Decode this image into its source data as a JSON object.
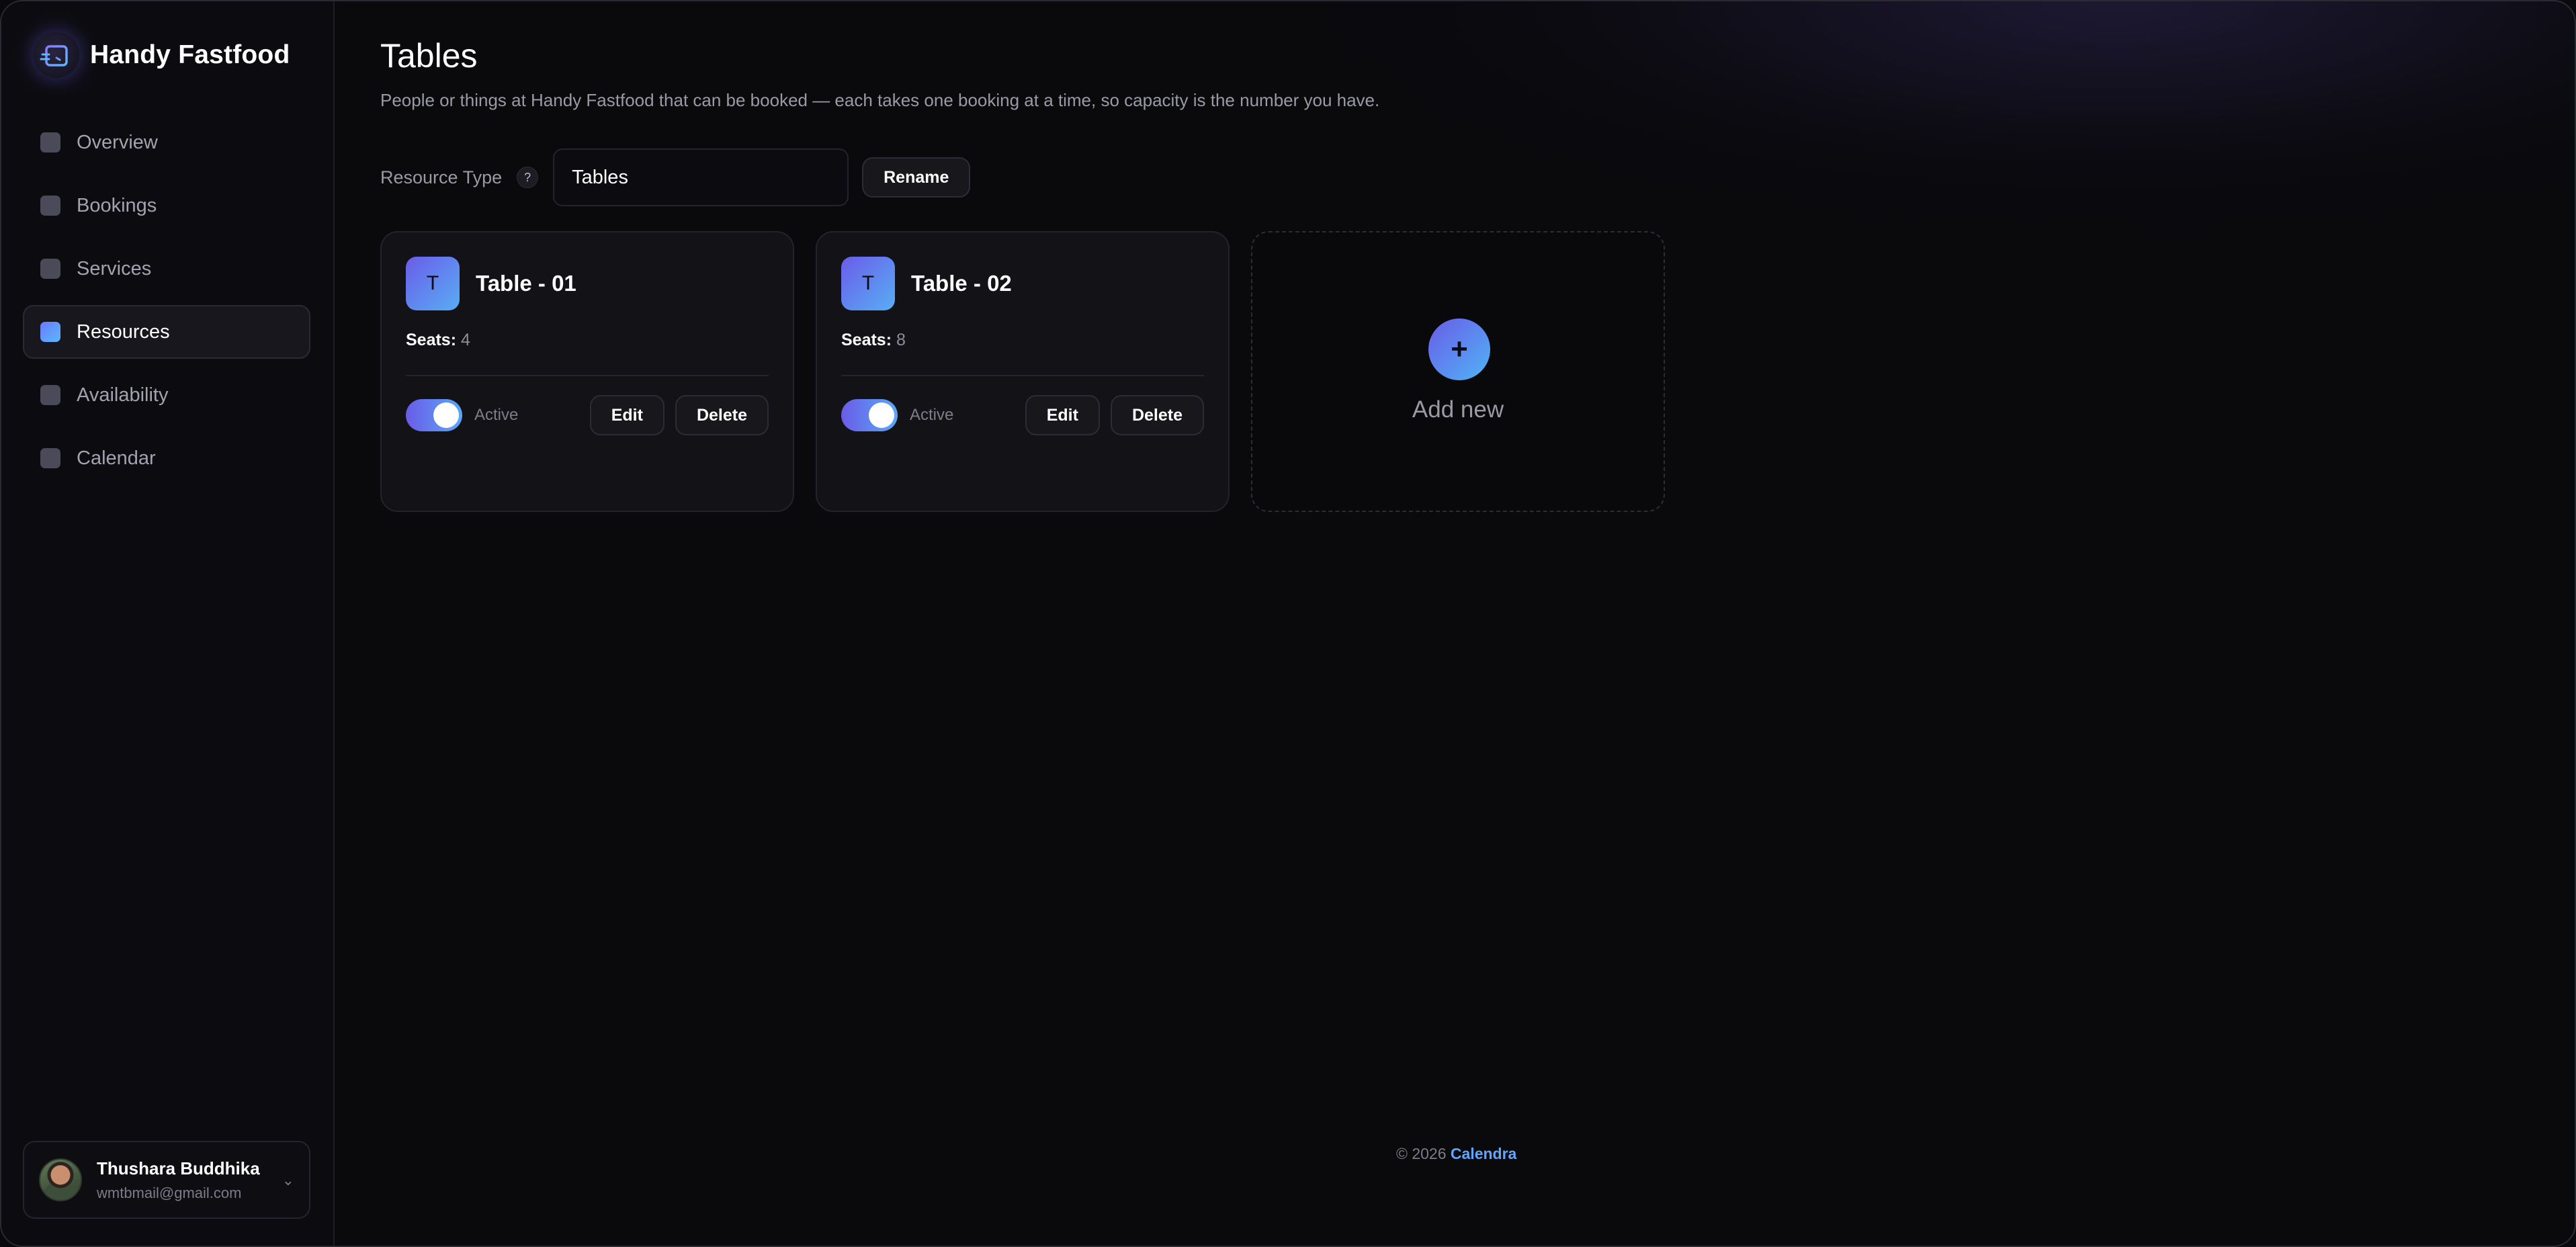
{
  "app": {
    "name": "Handy Fastfood",
    "accent": "#6a5ce8",
    "accent_2": "#58aef5"
  },
  "sidebar": {
    "items": [
      {
        "label": "Overview",
        "active": false
      },
      {
        "label": "Bookings",
        "active": false
      },
      {
        "label": "Services",
        "active": false
      },
      {
        "label": "Resources",
        "active": true
      },
      {
        "label": "Availability",
        "active": false
      },
      {
        "label": "Calendar",
        "active": false
      }
    ],
    "user": {
      "name": "Thushara Buddhika",
      "email": "wmtbmail@gmail.com"
    }
  },
  "main": {
    "title": "Tables",
    "subtitle": "People or things at Handy Fastfood that can be booked — each takes one booking at a time, so capacity is the number you have.",
    "resource_type": {
      "label": "Resource Type",
      "help": "?",
      "value": "Tables",
      "rename_label": "Rename"
    },
    "cards": [
      {
        "initial": "T",
        "name": "Table - 01",
        "seats_label": "Seats:",
        "seats": "4",
        "status_label": "Active",
        "active": true,
        "edit_label": "Edit",
        "delete_label": "Delete"
      },
      {
        "initial": "T",
        "name": "Table - 02",
        "seats_label": "Seats:",
        "seats": "8",
        "status_label": "Active",
        "active": true,
        "edit_label": "Edit",
        "delete_label": "Delete"
      }
    ],
    "add_new": {
      "icon": "+",
      "label": "Add new"
    }
  },
  "footer": {
    "copyright": "© 2026",
    "link": "Calendra"
  }
}
